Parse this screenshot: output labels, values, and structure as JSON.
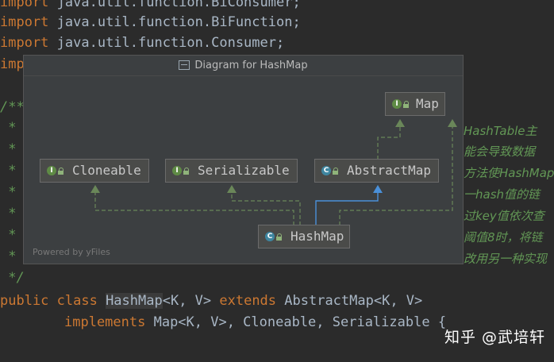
{
  "code": {
    "line1": {
      "kw": "import",
      "rest": " java.util.function.BiConsumer;"
    },
    "line2": {
      "kw": "import",
      "rest": " java.util.function.BiFunction;"
    },
    "line3": {
      "kw": "import",
      "rest": " java.util.function.Consumer;"
    },
    "line4": {
      "kw": "imp"
    },
    "line5": "/**",
    "star": " *",
    "end_comment": " */",
    "class_decl": {
      "kw1": "public class ",
      "name": "HashMap",
      "gen1": "<K, V> ",
      "kw2": "extends ",
      "sup": "AbstractMap",
      "gen2": "<K, V>"
    },
    "impl_line": {
      "kw": "implements ",
      "rest": "Map<K, V>, Cloneable, Serializable {"
    }
  },
  "comment_fragments": [
    "HashTable主",
    "能会导致数据",
    "方法使HashMap",
    "一hash值的链",
    "过key值依次查",
    "阈值8时，将链",
    "改用另一种实现"
  ],
  "popup": {
    "title": "Diagram for HashMap",
    "powered_by": "Powered by yFiles",
    "nodes": {
      "map": {
        "label": "Map",
        "kind": "I"
      },
      "cloneable": {
        "label": "Cloneable",
        "kind": "I"
      },
      "serializable": {
        "label": "Serializable",
        "kind": "I"
      },
      "abstractmap": {
        "label": "AbstractMap",
        "kind": "C"
      },
      "hashmap": {
        "label": "HashMap",
        "kind": "C"
      }
    }
  },
  "watermark": "知乎 @武培轩",
  "colors": {
    "keyword": "#cc7832",
    "comment": "#629755",
    "text": "#a9b7c6",
    "implements_edge": "#6a8759",
    "extends_edge": "#4a90d9"
  }
}
